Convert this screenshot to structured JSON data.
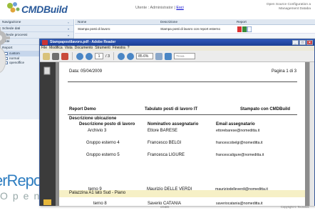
{
  "app": {
    "logo_text": "CMDBuild",
    "user_bar": {
      "prefix": "Utente : Administrator | ",
      "link": "Esci"
    },
    "oss_line1": "Open Source Configuration a",
    "oss_line2": "Management Databa",
    "nav": [
      {
        "label": "Navigazione"
      },
      {
        "label": "Schede dati"
      },
      {
        "label": "Schede processi"
      },
      {
        "label": "Viste"
      },
      {
        "label": "Report"
      }
    ],
    "nav_sub": [
      "custom",
      "normal",
      "openoffice"
    ],
    "grid_headers": {
      "name": "Nome",
      "desc": "Descrizione",
      "report": "Report"
    },
    "grid_row": {
      "name": "Stampa posti di lavoro",
      "desc": "Stampa posti di lavoro con report esterno"
    },
    "footer_credits": "credits",
    "footer_copy": "Copyright © Tecnotec"
  },
  "jasper": {
    "brand": "erReports",
    "sub": "OpenSource"
  },
  "adobe": {
    "title": "Stampapostilavoro.pdf - Adobe Reader",
    "menu": [
      "File",
      "Modifica",
      "Vista",
      "Documento",
      "Strumenti",
      "Finestra",
      "?"
    ],
    "page_current": "1",
    "page_total": "/ 3",
    "zoom": "85.6%",
    "find_placeholder": "Trova"
  },
  "report": {
    "date": "Data: 05/04/2009",
    "page": "Pagina 1 di   3",
    "header_left": "Report Demo",
    "header_center": "Tabulato posti di lavoro IT",
    "header_right": "Stampato con CMDBuild",
    "section": "Descrizione ubicazione",
    "col1": "Descrizione posto di lavoro",
    "col2": "Nominativo assegnatario",
    "col3": "Email assegnatario",
    "rows": [
      {
        "c1": "Archivio 3",
        "c2": "Ettore BARESE",
        "c3": "ettorebarese@nomeditta.it"
      },
      {
        "c1": "Gruppo esterno 4",
        "c2": "Francesco BELGI",
        "c3": "francescobelgi@nomeditta.it"
      },
      {
        "c1": "Gruppo esterno 5",
        "c2": "Francesca LIGURE",
        "c3": "francescaligure@nomeditta.it"
      }
    ],
    "group2": "Palazzina A1 lato Sud - Piano",
    "rows2": [
      {
        "c1": "terno 8",
        "c2": "Saverio CATANIA",
        "c3": "saveriocatania@nomeditta.it"
      },
      {
        "c1": "terno 9",
        "c2": "Maurizio DELLE VERDI",
        "c3": "mauriziodelleverdi@nomeditta.it"
      }
    ]
  }
}
